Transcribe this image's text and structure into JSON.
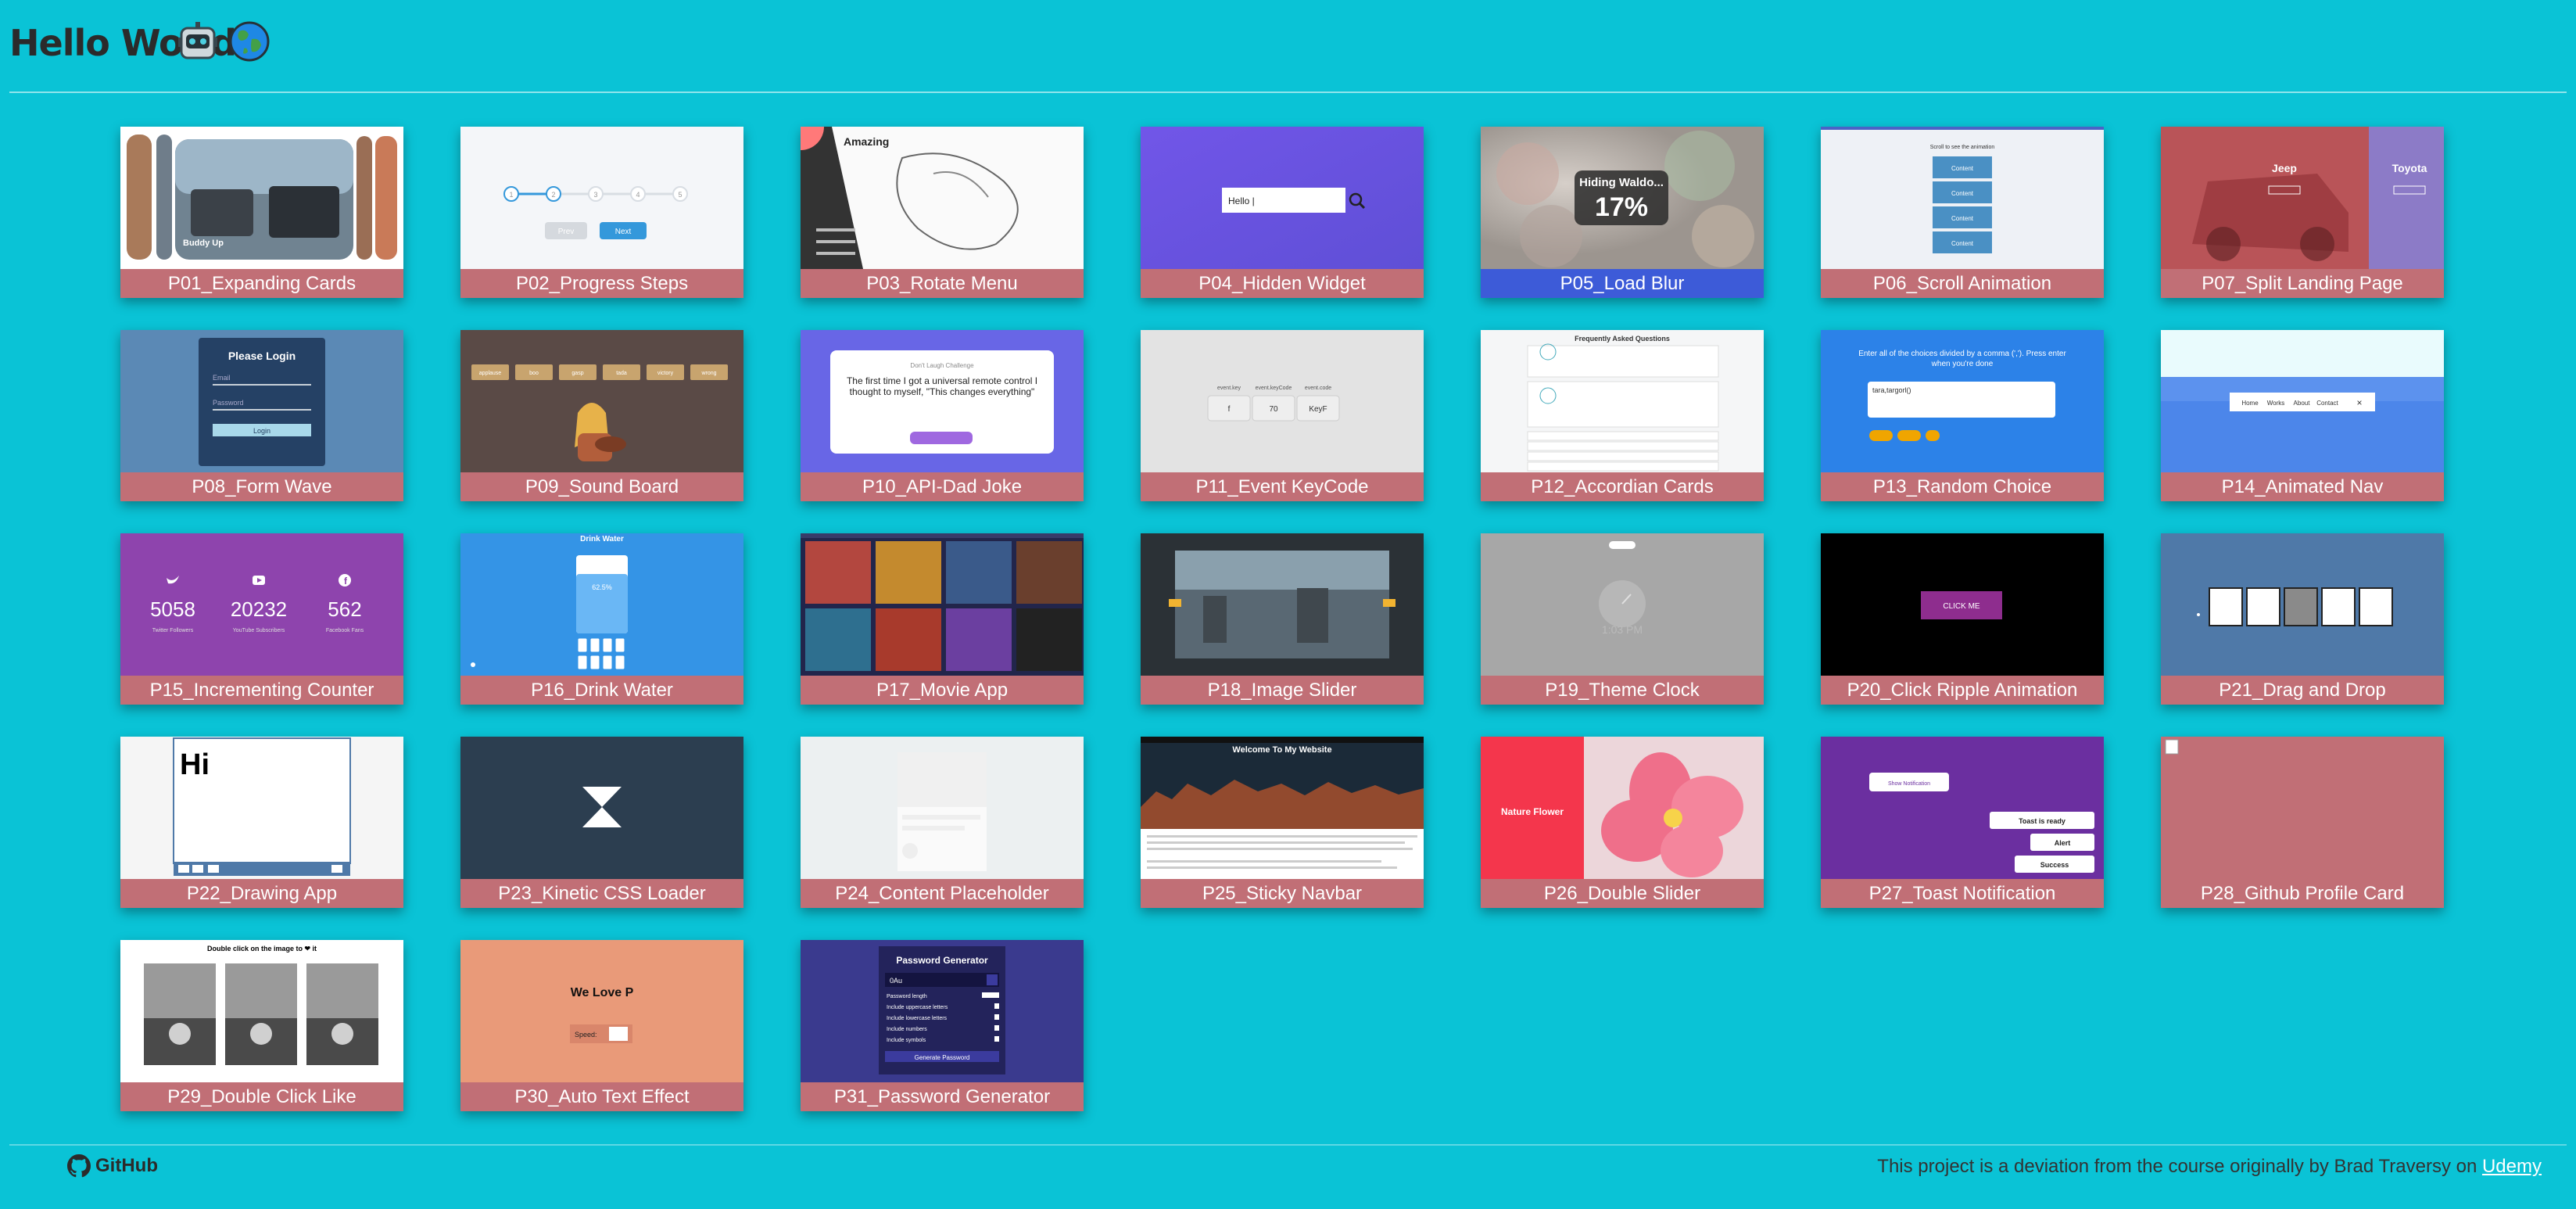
{
  "header": {
    "title": "Hello World",
    "icons": [
      "robot-icon",
      "globe-icon"
    ]
  },
  "colors": {
    "background": "#0ac3d6",
    "label_bar": "#c16f76",
    "label_bar_active": "#3d5bd8"
  },
  "projects": [
    {
      "label": "P01_Expanding Cards",
      "thumb": "expanding"
    },
    {
      "label": "P02_Progress Steps",
      "thumb": "progress"
    },
    {
      "label": "P03_Rotate Menu",
      "thumb": "rotate"
    },
    {
      "label": "P04_Hidden Widget",
      "thumb": "hidden"
    },
    {
      "label": "P05_Load Blur",
      "thumb": "blur",
      "active": true
    },
    {
      "label": "P06_Scroll Animation",
      "thumb": "scroll"
    },
    {
      "label": "P07_Split Landing Page",
      "thumb": "split"
    },
    {
      "label": "P08_Form Wave",
      "thumb": "form"
    },
    {
      "label": "P09_Sound Board",
      "thumb": "sound"
    },
    {
      "label": "P10_API-Dad Joke",
      "thumb": "joke"
    },
    {
      "label": "P11_Event KeyCode",
      "thumb": "keycode"
    },
    {
      "label": "P12_Accordian Cards",
      "thumb": "accordion"
    },
    {
      "label": "P13_Random Choice",
      "thumb": "random"
    },
    {
      "label": "P14_Animated Nav",
      "thumb": "nav"
    },
    {
      "label": "P15_Incrementing Counter",
      "thumb": "counter"
    },
    {
      "label": "P16_Drink Water",
      "thumb": "water"
    },
    {
      "label": "P17_Movie App",
      "thumb": "movie"
    },
    {
      "label": "P18_Image Slider",
      "thumb": "slider"
    },
    {
      "label": "P19_Theme Clock",
      "thumb": "clock"
    },
    {
      "label": "P20_Click Ripple Animation",
      "thumb": "ripple"
    },
    {
      "label": "P21_Drag and Drop",
      "thumb": "drag"
    },
    {
      "label": "P22_Drawing App",
      "thumb": "drawing"
    },
    {
      "label": "P23_Kinetic CSS Loader",
      "thumb": "kinetic"
    },
    {
      "label": "P24_Content Placeholder",
      "thumb": "placeholder"
    },
    {
      "label": "P25_Sticky Navbar",
      "thumb": "sticky"
    },
    {
      "label": "P26_Double Slider",
      "thumb": "double"
    },
    {
      "label": "P27_Toast Notification",
      "thumb": "toast"
    },
    {
      "label": "P28_Github Profile Card",
      "thumb": "github"
    },
    {
      "label": "P29_Double Click Like",
      "thumb": "like"
    },
    {
      "label": "P30_Auto Text Effect",
      "thumb": "autotext"
    },
    {
      "label": "P31_Password Generator",
      "thumb": "password"
    }
  ],
  "thumb_text": {
    "expanding_caption": "Buddy Up",
    "progress_prev": "Prev",
    "progress_next": "Next",
    "progress_steps": [
      "1",
      "2",
      "3",
      "4",
      "5"
    ],
    "rotate_title": "Amazing",
    "hidden_input": "Hello |",
    "blur_title": "Hiding Waldo...",
    "blur_percent": "17%",
    "scroll_title": "Scroll to see the animation",
    "scroll_item": "Content",
    "split_left": "Jeep",
    "split_right": "Toyota",
    "form_title": "Please Login",
    "form_email": "Email",
    "form_password": "Password",
    "form_button": "Login",
    "sound_buttons": [
      "applause",
      "boo",
      "gasp",
      "tada",
      "victory",
      "wrong"
    ],
    "joke_heading": "Don't Laugh Challenge",
    "joke_text": "The first time I got a universal remote control I thought to myself, \"This changes everything\"",
    "keycode_labels": [
      "event.key",
      "event.keyCode",
      "event.code"
    ],
    "keycode_values": [
      "f",
      "70",
      "KeyF"
    ],
    "accordion_title": "Frequently Asked Questions",
    "random_text": "Enter all of the choices divided by a comma (','). Press enter when you're done",
    "random_input": "tara,targorl()",
    "nav_items": [
      "Home",
      "Works",
      "About",
      "Contact"
    ],
    "counter_values": [
      "5058",
      "20232",
      "562"
    ],
    "counter_labels": [
      "Twitter Followers",
      "YouTube Subscribers",
      "Facebook Fans"
    ],
    "water_title": "Drink Water",
    "water_level": "62.5%",
    "clock_time": "1:03 PM",
    "ripple_button": "CLICK ME",
    "drawing_text": "Hi",
    "sticky_title": "Welcome To My Website",
    "double_title": "Nature Flower",
    "toast_button": "Show Notification",
    "toast_items": [
      "Toast is ready",
      "Alert",
      "Success"
    ],
    "like_title": "Double click on the image to ❤ it",
    "autotext_text": "We Love P",
    "autotext_speed": "Speed:",
    "password_title": "Password Generator",
    "password_rows": [
      "Password length",
      "Include uppercase letters",
      "Include lowercase letters",
      "Include numbers",
      "Include symbols"
    ],
    "password_button": "Generate Password",
    "password_value": "0Au"
  },
  "footer": {
    "github_label": "GitHub",
    "text": "This project is a deviation from the course originally by Brad Traversy on ",
    "link": "Udemy"
  }
}
